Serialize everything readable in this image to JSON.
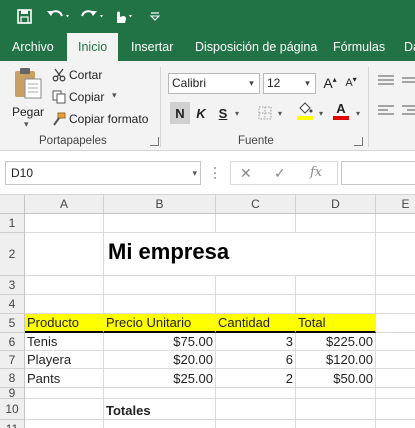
{
  "colors": {
    "accent": "#217346",
    "highlight": "#ffff00",
    "ribbon": "#f3f3f3"
  },
  "qat": {
    "items": [
      "save-icon",
      "undo-icon",
      "redo-icon",
      "touch-mode-icon",
      "customize-icon"
    ]
  },
  "tabs": [
    "Archivo",
    "Inicio",
    "Insertar",
    "Disposición de página",
    "Fórmulas",
    "Da"
  ],
  "active_tab": "Inicio",
  "ribbon": {
    "clipboard": {
      "paste_label": "Pegar",
      "cut_label": "Cortar",
      "copy_label": "Copiar",
      "format_painter_label": "Copiar formato",
      "group_label": "Portapapeles"
    },
    "font": {
      "font_name": "Calibri",
      "font_size": "12",
      "bold": "N",
      "italic": "K",
      "underline": "S",
      "grow": "A",
      "shrink": "A",
      "font_color_letter": "A",
      "group_label": "Fuente"
    }
  },
  "formula_bar": {
    "name_box": "D10",
    "fx": "fx",
    "value": ""
  },
  "sheet": {
    "columns": [
      "A",
      "B",
      "C",
      "D",
      "E"
    ],
    "rows": [
      "1",
      "2",
      "3",
      "4",
      "5",
      "6",
      "7",
      "8",
      "9",
      "10",
      "11"
    ],
    "title": "Mi empresa",
    "headers": [
      "Producto",
      "Precio Unitario",
      "Cantidad",
      "Total"
    ],
    "data": [
      [
        "Tenis",
        "$75.00",
        "3",
        "$225.00"
      ],
      [
        "Playera",
        "$20.00",
        "6",
        "$120.00"
      ],
      [
        "Pants",
        "$25.00",
        "2",
        "$50.00"
      ]
    ],
    "totals_label": "Totales"
  }
}
